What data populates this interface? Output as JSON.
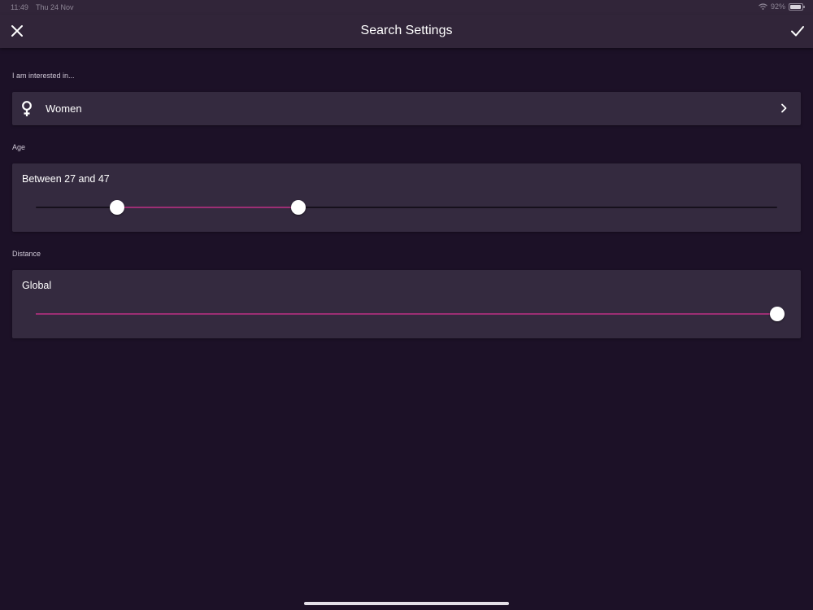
{
  "status_bar": {
    "time": "11:49",
    "date": "Thu 24 Nov",
    "battery": "92%",
    "battery_level": 0.92
  },
  "header": {
    "title": "Search Settings",
    "close_icon": "close-icon",
    "done_icon": "checkmark-icon"
  },
  "interest": {
    "label": "I am interested in...",
    "value": "Women",
    "icon": "female-symbol-icon"
  },
  "age": {
    "label": "Age",
    "summary": "Between 27 and 47",
    "min_fraction": 0.11,
    "max_fraction": 0.354
  },
  "distance": {
    "label": "Distance",
    "summary": "Global",
    "fraction": 1.0
  },
  "colors": {
    "background": "#1c1127",
    "bar": "#312539",
    "card": "#342a3f",
    "accent": "#9c2e74"
  }
}
